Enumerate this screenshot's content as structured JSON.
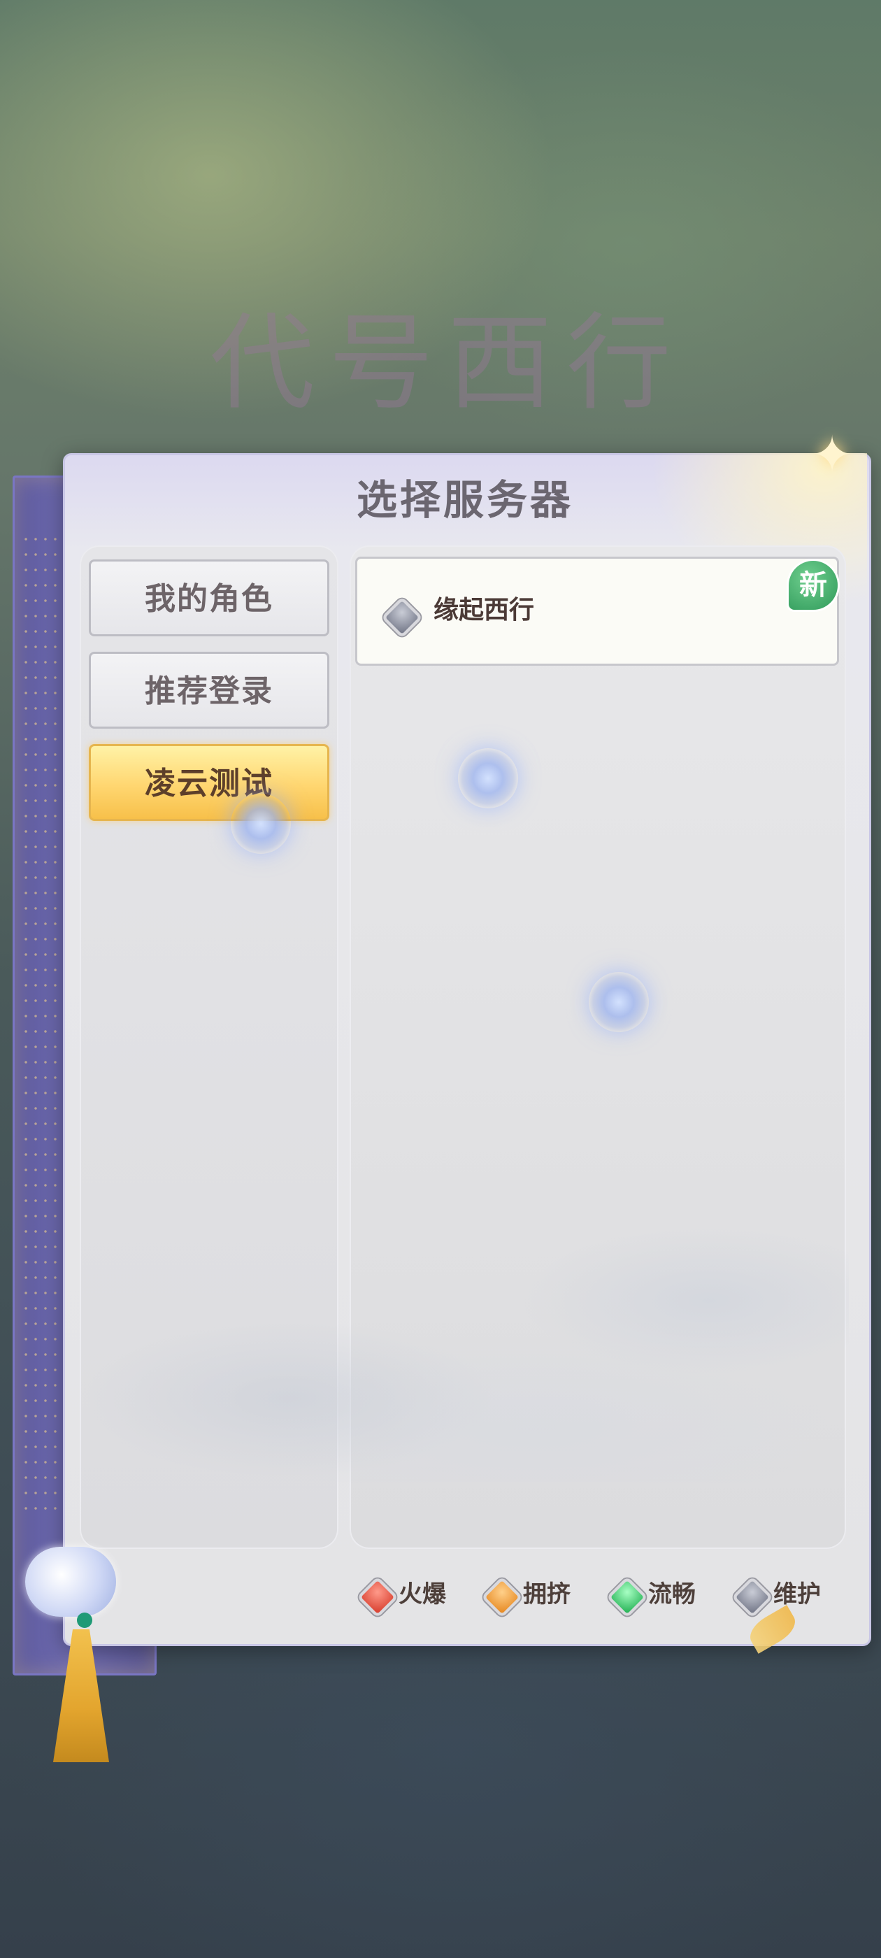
{
  "background": {
    "game_title": "代号西行"
  },
  "dialog": {
    "title": "选择服务器"
  },
  "categories": [
    {
      "label": "我的角色",
      "active": false
    },
    {
      "label": "推荐登录",
      "active": false
    },
    {
      "label": "凌云测试",
      "active": true
    }
  ],
  "servers": [
    {
      "name": "缘起西行",
      "status": "维护",
      "badge": "新"
    }
  ],
  "legend": [
    {
      "label": "火爆",
      "color": "#d63a2a"
    },
    {
      "label": "拥挤",
      "color": "#e5861e"
    },
    {
      "label": "流畅",
      "color": "#1fae50"
    },
    {
      "label": "维护",
      "color": "#6f7384"
    }
  ],
  "icons": {
    "corner": "butterfly-icon",
    "status": "gem-icon",
    "decoration": "cloud-pendant-icon"
  }
}
